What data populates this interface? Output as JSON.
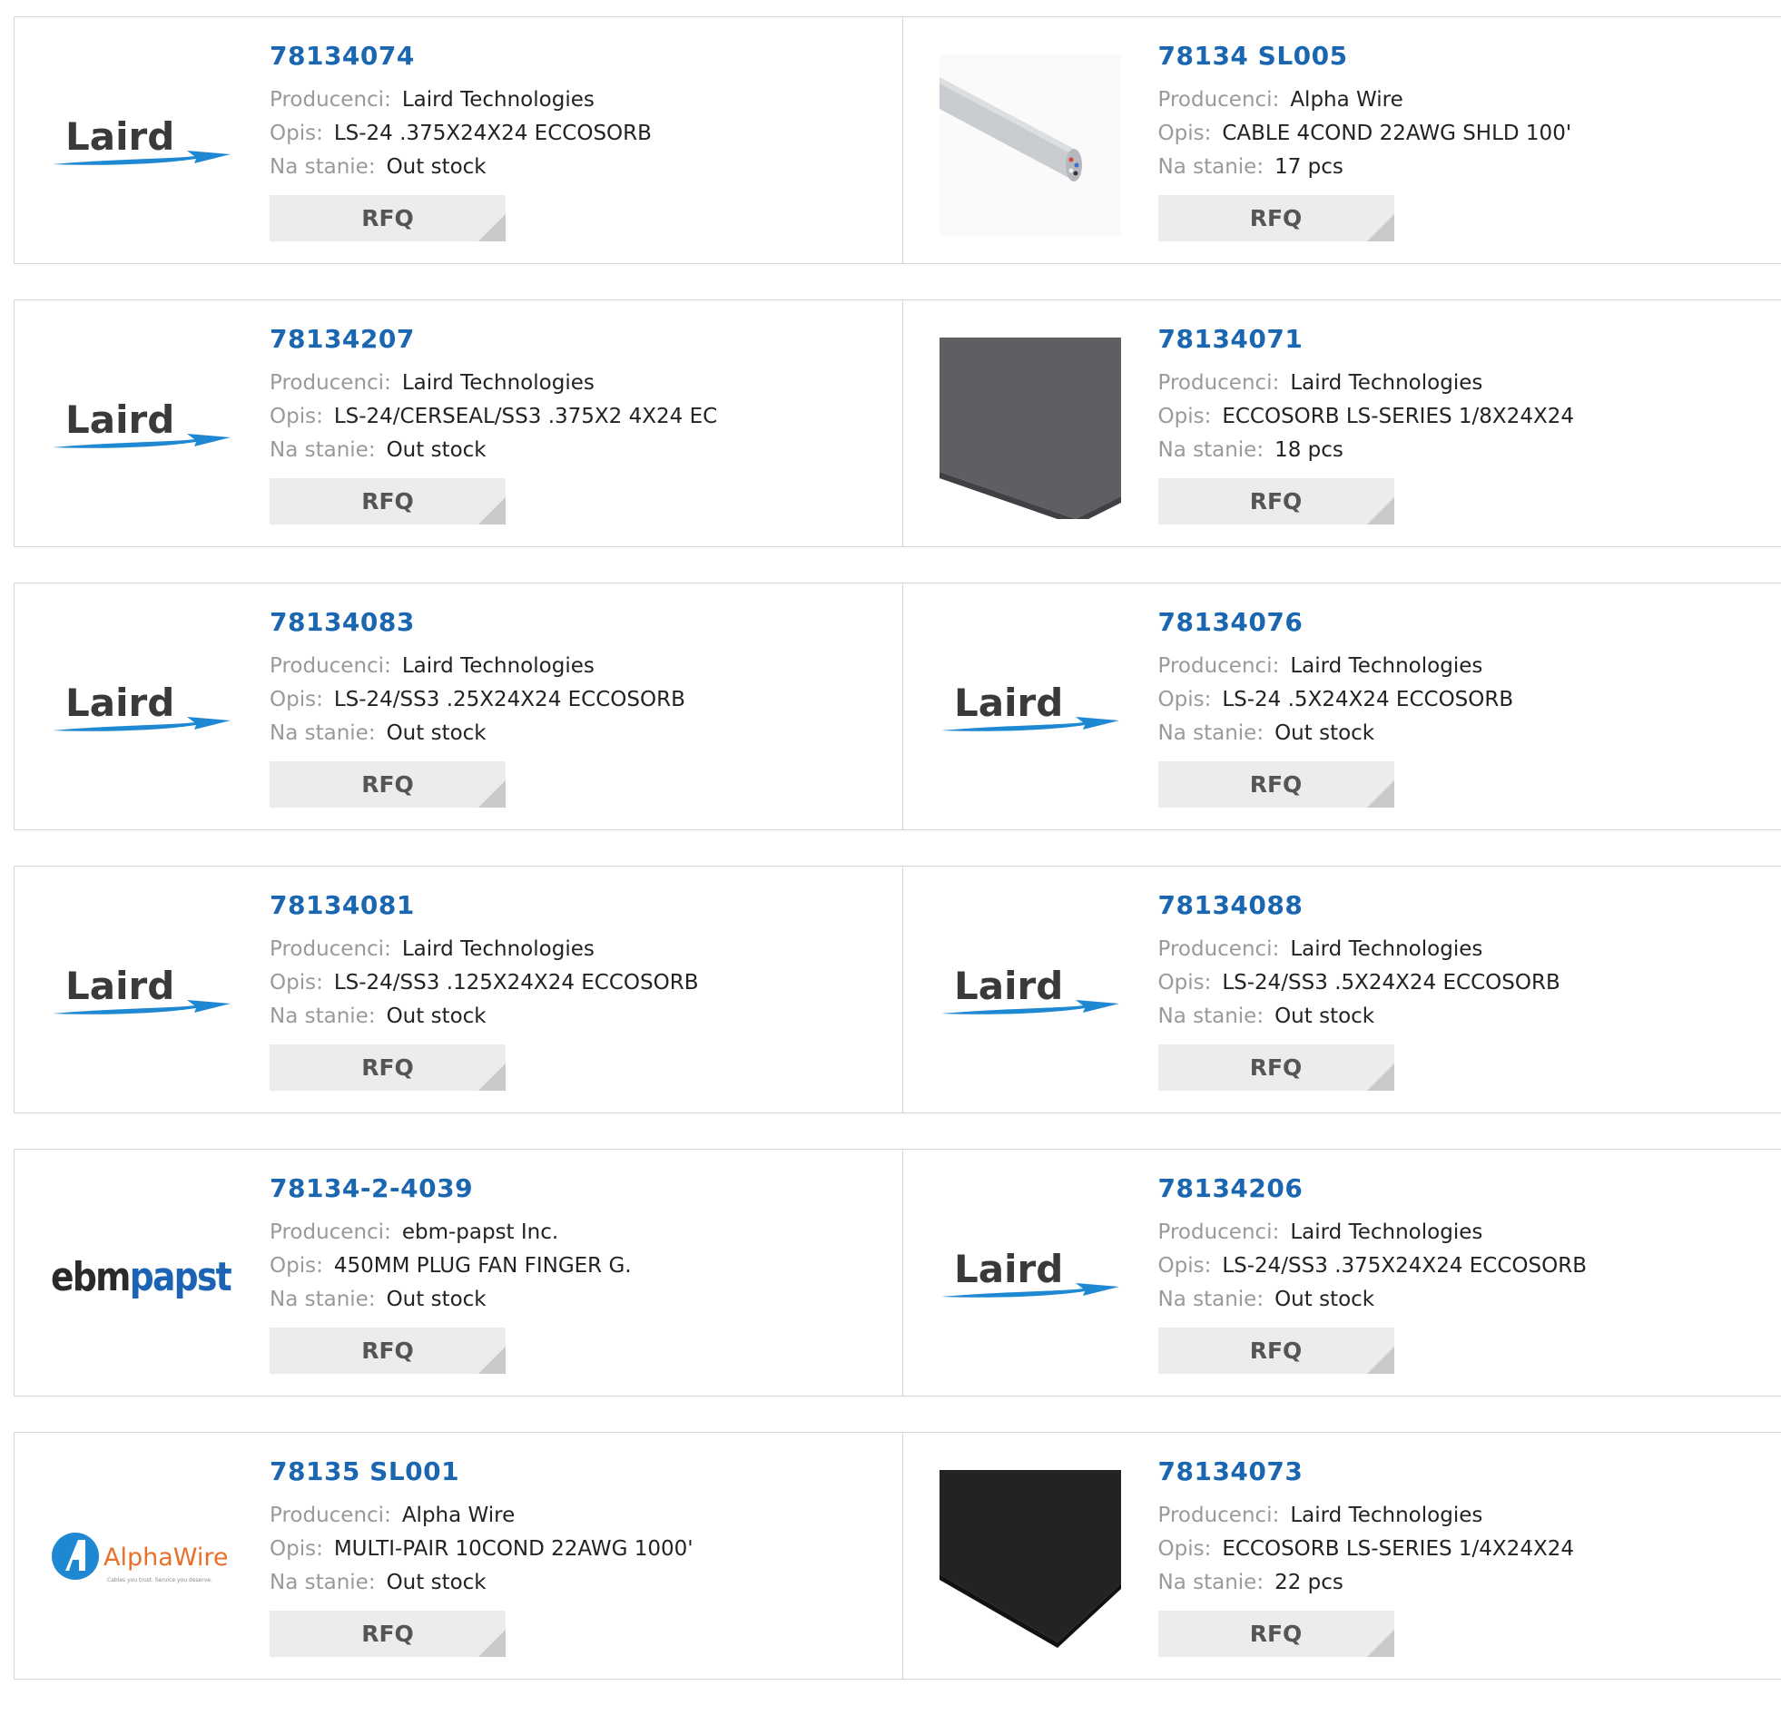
{
  "labels": {
    "manufacturer": "Producenci:",
    "description": "Opis:",
    "stock": "Na stanie:",
    "rfq": "RFQ"
  },
  "rows": [
    [
      {
        "part": "78134074",
        "manufacturer": "Laird Technologies",
        "description": "LS-24 .375X24X24 ECCOSORB",
        "stock": "Out stock",
        "image": "laird-logo"
      },
      {
        "part": "78134 SL005",
        "manufacturer": "Alpha Wire",
        "description": "CABLE 4COND 22AWG SHLD 100'",
        "stock": "17 pcs",
        "image": "cable-photo"
      }
    ],
    [
      {
        "part": "78134207",
        "manufacturer": "Laird Technologies",
        "description": "LS-24/CERSEAL/SS3 .375X2 4X24 EC",
        "stock": "Out stock",
        "image": "laird-logo"
      },
      {
        "part": "78134071",
        "manufacturer": "Laird Technologies",
        "description": "ECCOSORB LS-SERIES 1/8X24X24",
        "stock": "18 pcs",
        "image": "grey-foam-photo"
      }
    ],
    [
      {
        "part": "78134083",
        "manufacturer": "Laird Technologies",
        "description": "LS-24/SS3 .25X24X24 ECCOSORB",
        "stock": "Out stock",
        "image": "laird-logo"
      },
      {
        "part": "78134076",
        "manufacturer": "Laird Technologies",
        "description": "LS-24 .5X24X24 ECCOSORB",
        "stock": "Out stock",
        "image": "laird-logo"
      }
    ],
    [
      {
        "part": "78134081",
        "manufacturer": "Laird Technologies",
        "description": "LS-24/SS3 .125X24X24 ECCOSORB",
        "stock": "Out stock",
        "image": "laird-logo"
      },
      {
        "part": "78134088",
        "manufacturer": "Laird Technologies",
        "description": "LS-24/SS3 .5X24X24 ECCOSORB",
        "stock": "Out stock",
        "image": "laird-logo"
      }
    ],
    [
      {
        "part": "78134-2-4039",
        "manufacturer": "ebm-papst Inc.",
        "description": "450MM PLUG FAN FINGER G.",
        "stock": "Out stock",
        "image": "ebmpapst-logo"
      },
      {
        "part": "78134206",
        "manufacturer": "Laird Technologies",
        "description": "LS-24/SS3 .375X24X24 ECCOSORB",
        "stock": "Out stock",
        "image": "laird-logo"
      }
    ],
    [
      {
        "part": "78135 SL001",
        "manufacturer": "Alpha Wire",
        "description": "MULTI-PAIR 10COND 22AWG 1000'",
        "stock": "Out stock",
        "image": "alphawire-logo"
      },
      {
        "part": "78134073",
        "manufacturer": "Laird Technologies",
        "description": "ECCOSORB LS-SERIES 1/4X24X24",
        "stock": "22 pcs",
        "image": "black-foam-photo"
      }
    ]
  ],
  "logos": {
    "laird": "Laird",
    "ebm": "ebm",
    "papst": "papst",
    "alphawire": "AlphaWire",
    "alphawire_tagline": "Cables you trust. Service you deserve."
  },
  "colors": {
    "part_link": "#1a66b0",
    "label": "#9a9a9a",
    "button_bg": "#ececec",
    "laird_swoosh": "#1e88d2",
    "papst_blue": "#1d63b4"
  }
}
